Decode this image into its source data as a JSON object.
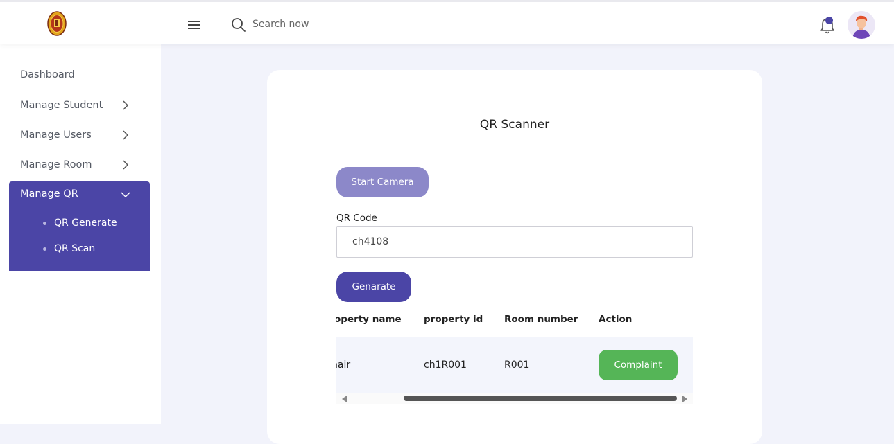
{
  "header": {
    "search_placeholder": "Search now",
    "icons": [
      "logo-emblem",
      "hamburger-menu-icon",
      "search-icon",
      "bell-icon",
      "avatar"
    ]
  },
  "sidebar": {
    "items": [
      {
        "label": "Dashboard"
      },
      {
        "label": "Manage Student"
      },
      {
        "label": "Manage Users"
      },
      {
        "label": "Manage Room"
      }
    ],
    "active_group": {
      "label": "Manage QR",
      "children": [
        {
          "label": "QR Generate"
        },
        {
          "label": "QR Scan"
        }
      ]
    }
  },
  "main": {
    "title": "QR Scanner",
    "start_camera_label": "Start Camera",
    "qr_code_label": "QR Code",
    "qr_code_value": "ch4108",
    "generate_label": "Genarate",
    "table": {
      "columns": [
        "operty name",
        "property id",
        "Room number",
        "Action"
      ],
      "rows": [
        {
          "property_name": "nair",
          "property_id": "ch1R001",
          "room_number": "R001",
          "action": "Complaint"
        }
      ]
    }
  },
  "colors": {
    "accent": "#4b45a6",
    "accent_light": "#8c88c9",
    "success": "#55b557",
    "background": "#f2f3fb"
  }
}
